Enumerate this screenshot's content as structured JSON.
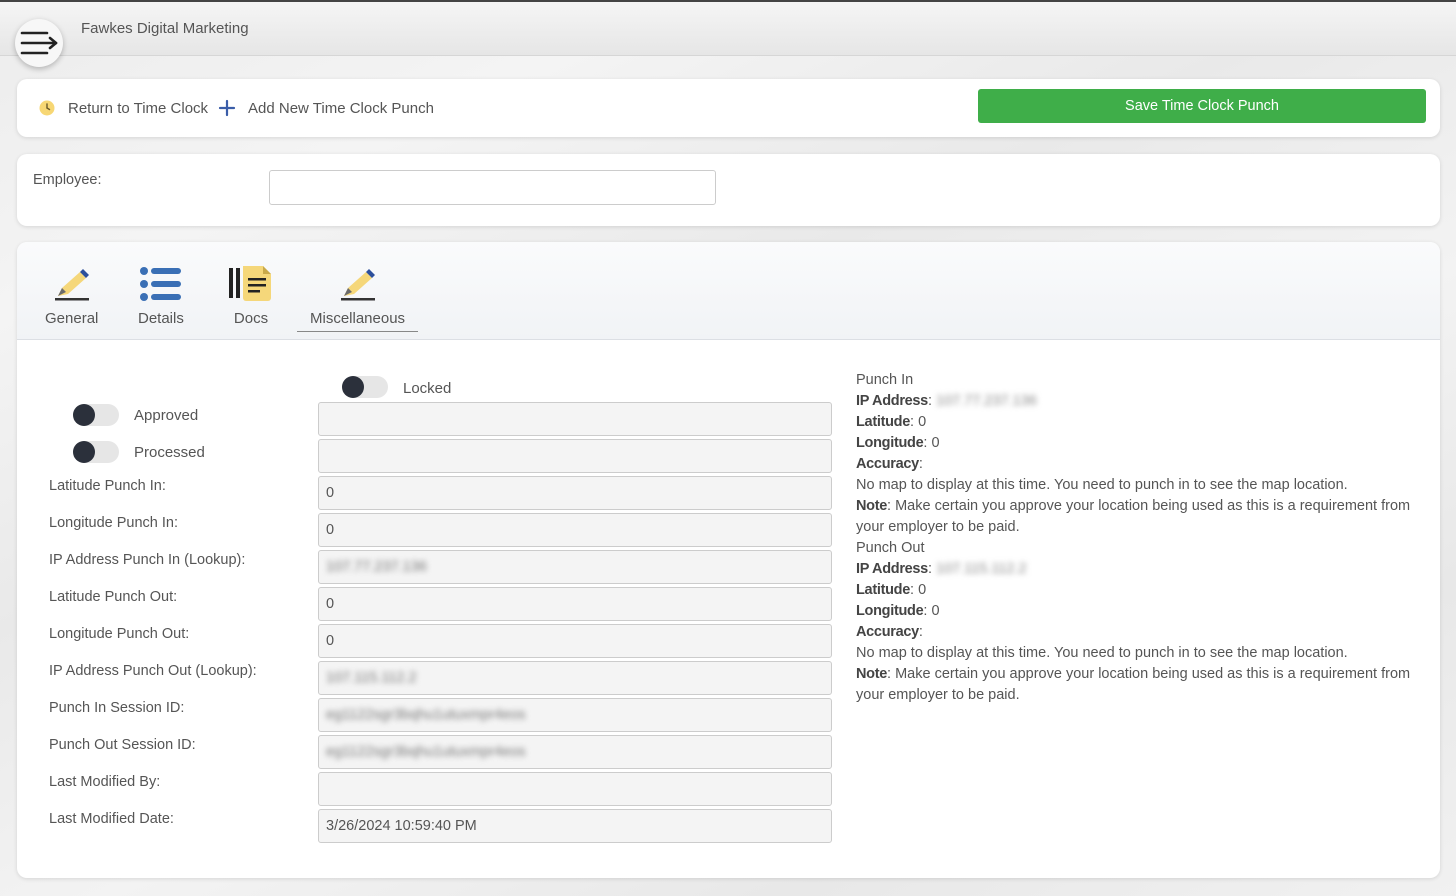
{
  "header": {
    "company": "Fawkes Digital Marketing"
  },
  "toolbar": {
    "return_label": "Return to Time Clock",
    "add_label": "Add New Time Clock Punch",
    "save_label": "Save Time Clock Punch"
  },
  "employee": {
    "label": "Employee:",
    "value": ""
  },
  "tabs": [
    {
      "label": "General"
    },
    {
      "label": "Details"
    },
    {
      "label": "Docs"
    },
    {
      "label": "Miscellaneous"
    }
  ],
  "toggles": {
    "locked": "Locked",
    "approved": "Approved",
    "processed": "Processed"
  },
  "fields": {
    "locked_value": "",
    "approved_value": "",
    "processed_value": "",
    "lat_in_label": "Latitude Punch In:",
    "lat_in_value": "0",
    "lon_in_label": "Longitude Punch In:",
    "lon_in_value": "0",
    "ip_in_label": "IP Address Punch In (Lookup):",
    "ip_in_value": "107.77.237.136",
    "lat_out_label": "Latitude Punch Out:",
    "lat_out_value": "0",
    "lon_out_label": "Longitude Punch Out:",
    "lon_out_value": "0",
    "ip_out_label": "IP Address Punch Out (Lookup):",
    "ip_out_value": "107.115.112.2",
    "sess_in_label": "Punch In Session ID:",
    "sess_in_value": "eg1122sgr3bqhu1utuxmpr4eos",
    "sess_out_label": "Punch Out Session ID:",
    "sess_out_value": "eg1122sgr3bqhu1utuxmpr4eos",
    "modby_label": "Last Modified By:",
    "modby_value": "",
    "moddate_label": "Last Modified Date:",
    "moddate_value": "3/26/2024 10:59:40 PM"
  },
  "punch_in": {
    "heading": "Punch In",
    "ip_label": "IP Address",
    "ip_value": "107.77.237.136",
    "lat_label": "Latitude",
    "lat_value": "0",
    "lon_label": "Longitude",
    "lon_value": "0",
    "acc_label": "Accuracy",
    "acc_value": "",
    "map_msg": "No map to display at this time. You need to punch in to see the map location.",
    "note_label": "Note",
    "note_text": "Make certain you approve your location being used as this is a requirement from your employer to be paid."
  },
  "punch_out": {
    "heading": "Punch Out",
    "ip_label": "IP Address",
    "ip_value": "107.115.112.2",
    "lat_label": "Latitude",
    "lat_value": "0",
    "lon_label": "Longitude",
    "lon_value": "0",
    "acc_label": "Accuracy",
    "acc_value": "",
    "map_msg": "No map to display at this time. You need to punch in to see the map location.",
    "note_label": "Note",
    "note_text": "Make certain you approve your location being used as this is a requirement from your employer to be paid."
  },
  "colors": {
    "save_button": "#3fae49",
    "toggle_knob": "#2b303b",
    "icon_blue": "#3a6fb5",
    "icon_yellow": "#f5d77a"
  }
}
